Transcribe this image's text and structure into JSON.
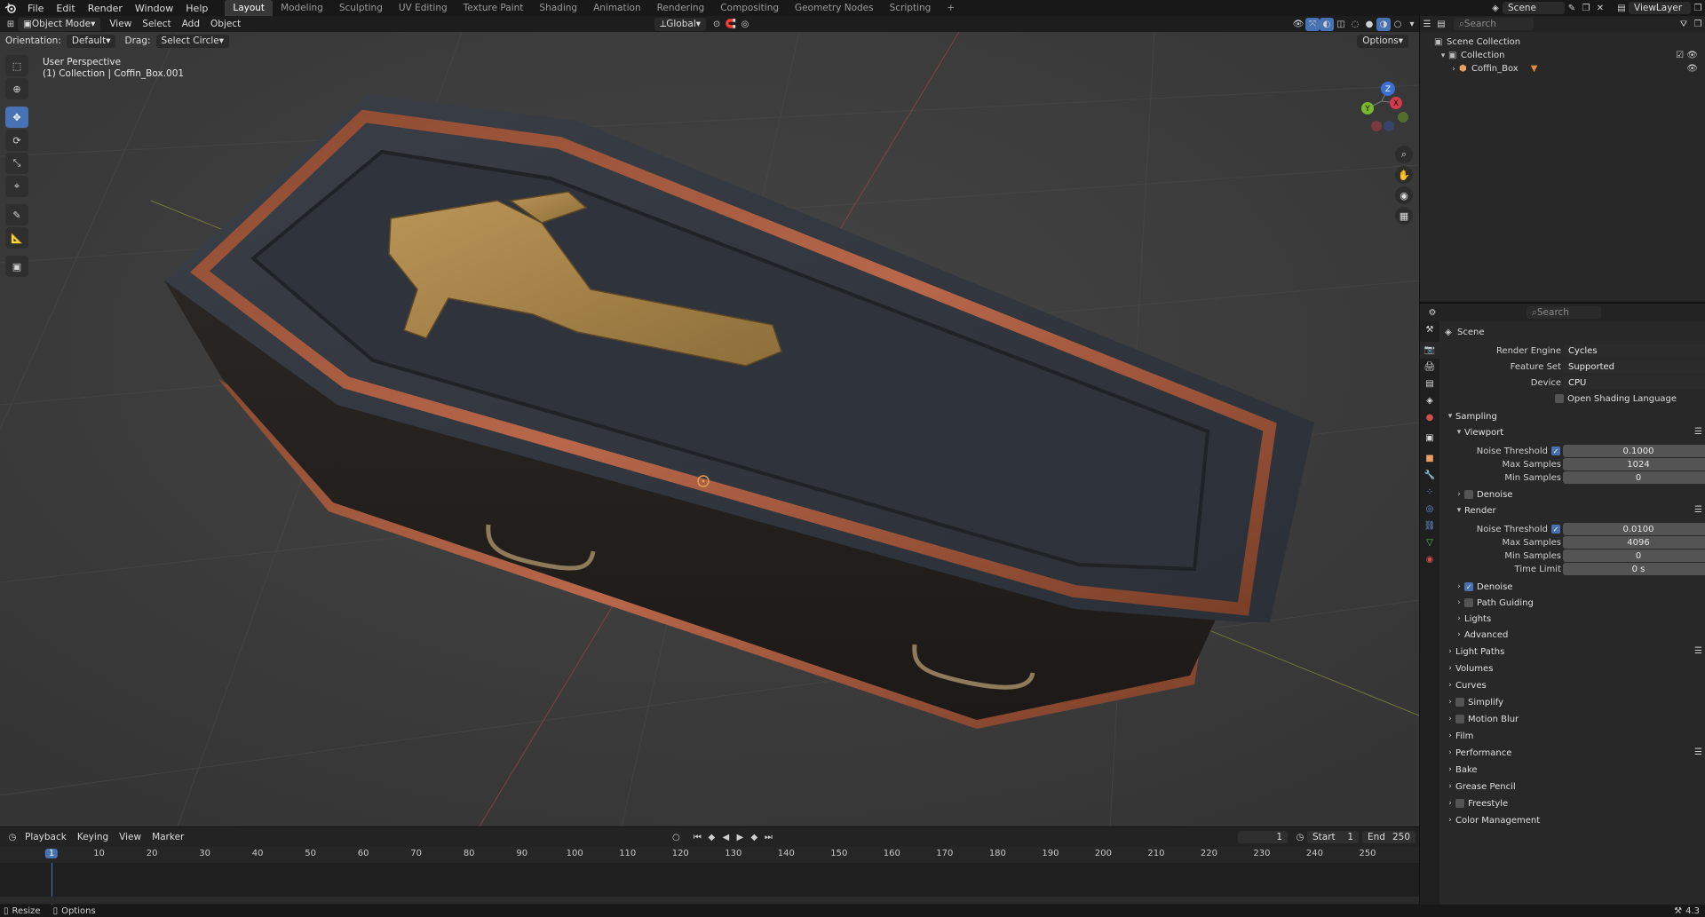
{
  "topbar": {
    "menus": [
      "File",
      "Edit",
      "Render",
      "Window",
      "Help"
    ],
    "workspaces": [
      "Layout",
      "Modeling",
      "Sculpting",
      "UV Editing",
      "Texture Paint",
      "Shading",
      "Animation",
      "Rendering",
      "Compositing",
      "Geometry Nodes",
      "Scripting"
    ],
    "active_workspace": "Layout",
    "add_tab": "+",
    "scene": "Scene",
    "view_layer": "ViewLayer"
  },
  "viewport_header": {
    "mode": "Object Mode",
    "menus": [
      "View",
      "Select",
      "Add",
      "Object"
    ],
    "transform_orientation": "Global",
    "options": "Options"
  },
  "tool_settings": {
    "orientation_label": "Orientation:",
    "orientation_value": "Default",
    "drag_label": "Drag:",
    "drag_value": "Select Circle"
  },
  "viewport": {
    "perspective": "User Perspective",
    "collection_info": "(1) Collection | Coffin_Box.001",
    "gizmo_axes": {
      "x": "X",
      "y": "Y",
      "z": "Z"
    }
  },
  "outliner": {
    "search_placeholder": "Search",
    "scene_collection": "Scene Collection",
    "collection": "Collection",
    "object": "Coffin_Box"
  },
  "properties": {
    "search_placeholder": "Search",
    "context": "Scene",
    "render_engine_label": "Render Engine",
    "render_engine": "Cycles",
    "feature_set_label": "Feature Set",
    "feature_set": "Supported",
    "device_label": "Device",
    "device": "CPU",
    "osl_label": "Open Shading Language",
    "sampling": "Sampling",
    "viewport": "Viewport",
    "noise_threshold_label": "Noise Threshold",
    "viewport_noise_threshold": "0.1000",
    "max_samples_label": "Max Samples",
    "viewport_max_samples": "1024",
    "min_samples_label": "Min Samples",
    "viewport_min_samples": "0",
    "denoise": "Denoise",
    "render": "Render",
    "render_noise_threshold": "0.0100",
    "render_max_samples": "4096",
    "render_min_samples": "0",
    "time_limit_label": "Time Limit",
    "time_limit": "0 s",
    "render_denoise": "Denoise",
    "path_guiding": "Path Guiding",
    "lights": "Lights",
    "advanced": "Advanced",
    "light_paths": "Light Paths",
    "volumes": "Volumes",
    "curves": "Curves",
    "simplify": "Simplify",
    "motion_blur": "Motion Blur",
    "film": "Film",
    "performance": "Performance",
    "bake": "Bake",
    "grease_pencil": "Grease Pencil",
    "freestyle": "Freestyle",
    "color_management": "Color Management"
  },
  "timeline": {
    "menus": [
      "Playback",
      "Keying",
      "View",
      "Marker"
    ],
    "current_frame": "1",
    "start_label": "Start",
    "start": "1",
    "end_label": "End",
    "end": "250",
    "ticks": [
      "1",
      "10",
      "20",
      "30",
      "40",
      "50",
      "60",
      "70",
      "80",
      "90",
      "100",
      "110",
      "120",
      "130",
      "140",
      "150",
      "160",
      "170",
      "180",
      "190",
      "200",
      "210",
      "220",
      "230",
      "240",
      "250"
    ]
  },
  "statusbar": {
    "resize": "Resize",
    "options": "Options",
    "version": "4.3"
  },
  "colors": {
    "accent": "#4772b3",
    "wood_dark": "#2a2d33",
    "copper_trim": "#a0583a",
    "brass_cross": "#a8874a"
  }
}
